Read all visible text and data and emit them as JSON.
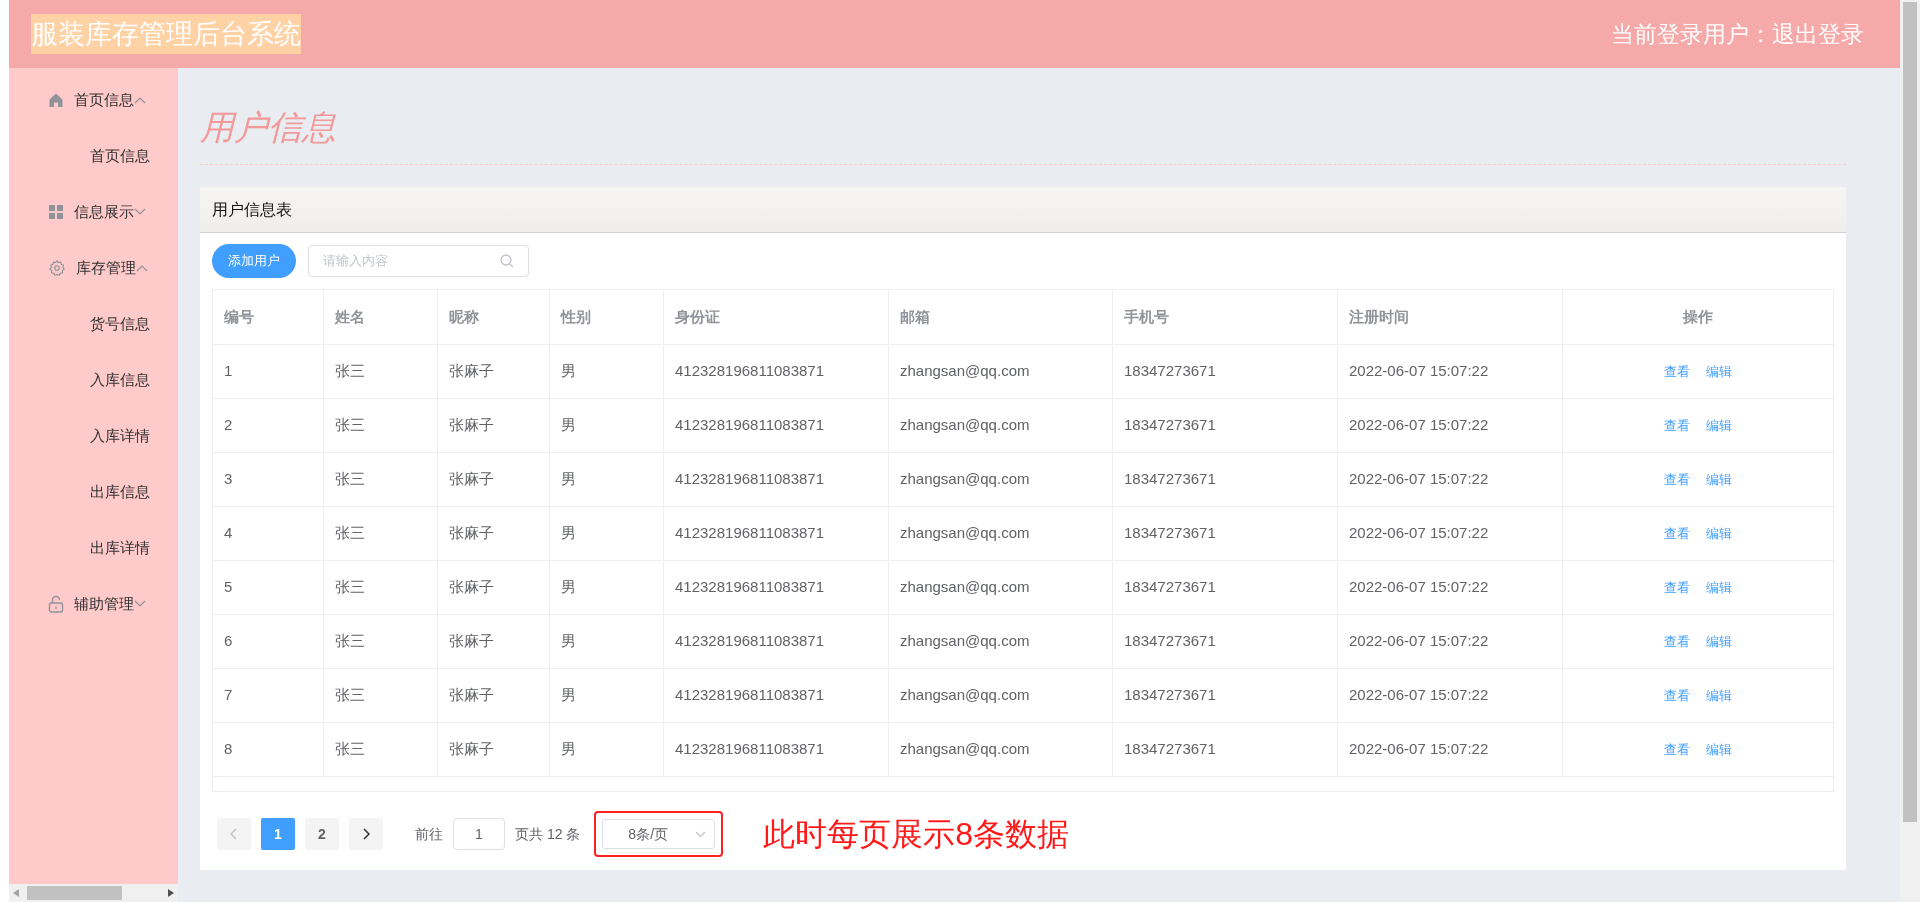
{
  "header": {
    "title": "服装库存管理后台系统",
    "user_label": "当前登录用户：",
    "logout": "退出登录"
  },
  "sidebar": {
    "menus": [
      {
        "label": "首页信息",
        "kind": "home",
        "expanded": true,
        "children": [
          {
            "label": "首页信息"
          }
        ]
      },
      {
        "label": "信息展示",
        "kind": "grid",
        "expanded": false
      },
      {
        "label": "库存管理",
        "kind": "gear",
        "expanded": true,
        "children": [
          {
            "label": "货号信息"
          },
          {
            "label": "入库信息"
          },
          {
            "label": "入库详情"
          },
          {
            "label": "出库信息"
          },
          {
            "label": "出库详情"
          }
        ]
      },
      {
        "label": "辅助管理",
        "kind": "lock",
        "expanded": false
      }
    ]
  },
  "page_title": "用户信息",
  "card": {
    "title": "用户信息表",
    "add_button": "添加用户",
    "search": {
      "placeholder": "请输入内容"
    }
  },
  "table": {
    "columns": [
      "编号",
      "姓名",
      "昵称",
      "性别",
      "身份证",
      "邮箱",
      "手机号",
      "注册时间",
      "操作"
    ],
    "rows": [
      {
        "cells": [
          "1",
          "张三",
          "张麻子",
          "男",
          "412328196811083871",
          "zhangsan@qq.com",
          "18347273671",
          "2022-06-07 15:07:22"
        ],
        "actions": [
          "查看",
          "编辑"
        ]
      },
      {
        "cells": [
          "2",
          "张三",
          "张麻子",
          "男",
          "412328196811083871",
          "zhangsan@qq.com",
          "18347273671",
          "2022-06-07 15:07:22"
        ],
        "actions": [
          "查看",
          "编辑"
        ]
      },
      {
        "cells": [
          "3",
          "张三",
          "张麻子",
          "男",
          "412328196811083871",
          "zhangsan@qq.com",
          "18347273671",
          "2022-06-07 15:07:22"
        ],
        "actions": [
          "查看",
          "编辑"
        ]
      },
      {
        "cells": [
          "4",
          "张三",
          "张麻子",
          "男",
          "412328196811083871",
          "zhangsan@qq.com",
          "18347273671",
          "2022-06-07 15:07:22"
        ],
        "actions": [
          "查看",
          "编辑"
        ]
      },
      {
        "cells": [
          "5",
          "张三",
          "张麻子",
          "男",
          "412328196811083871",
          "zhangsan@qq.com",
          "18347273671",
          "2022-06-07 15:07:22"
        ],
        "actions": [
          "查看",
          "编辑"
        ]
      },
      {
        "cells": [
          "6",
          "张三",
          "张麻子",
          "男",
          "412328196811083871",
          "zhangsan@qq.com",
          "18347273671",
          "2022-06-07 15:07:22"
        ],
        "actions": [
          "查看",
          "编辑"
        ]
      },
      {
        "cells": [
          "7",
          "张三",
          "张麻子",
          "男",
          "412328196811083871",
          "zhangsan@qq.com",
          "18347273671",
          "2022-06-07 15:07:22"
        ],
        "actions": [
          "查看",
          "编辑"
        ]
      },
      {
        "cells": [
          "8",
          "张三",
          "张麻子",
          "男",
          "412328196811083871",
          "zhangsan@qq.com",
          "18347273671",
          "2022-06-07 15:07:22"
        ],
        "actions": [
          "查看",
          "编辑"
        ]
      }
    ]
  },
  "pagination": {
    "pages": [
      {
        "label": "1",
        "selected": true
      },
      {
        "label": "2",
        "selected": false
      }
    ],
    "goto_label": "前往",
    "goto_value": "1",
    "total": "页共 12 条",
    "page_size": "8条/页"
  },
  "annotation": "此时每页展示8条数据"
}
